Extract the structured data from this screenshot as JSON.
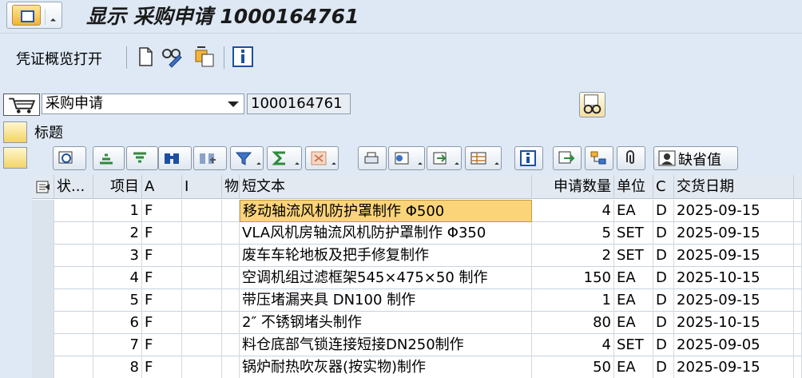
{
  "title": "显示 采购申请 1000164761",
  "toolbar": {
    "doc_overview": "凭证概览打开",
    "icons": [
      "new-document-icon",
      "glasses-pen-icon",
      "copy-icon",
      "info-icon"
    ]
  },
  "header": {
    "doc_type": "采购申请",
    "doc_number": "1000164761"
  },
  "section": {
    "label": "标题"
  },
  "alv_toolbar": {
    "default_label": "缺省值"
  },
  "table": {
    "columns": [
      "状...",
      "项目",
      "A",
      "I",
      "物",
      "短文本",
      "申请数量",
      "单位",
      "C",
      "交货日期"
    ],
    "rows": [
      {
        "item": "1",
        "a": "F",
        "text": "移动轴流风机防护罩制作 Φ500",
        "qty": "4",
        "unit": "EA",
        "c": "D",
        "date": "2025-09-15"
      },
      {
        "item": "2",
        "a": "F",
        "text": "VLA风机房轴流风机防护罩制作 Φ350",
        "qty": "5",
        "unit": "SET",
        "c": "D",
        "date": "2025-09-15"
      },
      {
        "item": "3",
        "a": "F",
        "text": "废车车轮地板及把手修复制作",
        "qty": "2",
        "unit": "SET",
        "c": "D",
        "date": "2025-09-15"
      },
      {
        "item": "4",
        "a": "F",
        "text": "空调机组过滤框架545×475×50 制作",
        "qty": "150",
        "unit": "EA",
        "c": "D",
        "date": "2025-10-15"
      },
      {
        "item": "5",
        "a": "F",
        "text": "带压堵漏夹具 DN100 制作",
        "qty": "1",
        "unit": "EA",
        "c": "D",
        "date": "2025-09-15"
      },
      {
        "item": "6",
        "a": "F",
        "text": "2″ 不锈钢堵头制作",
        "qty": "80",
        "unit": "EA",
        "c": "D",
        "date": "2025-10-15"
      },
      {
        "item": "7",
        "a": "F",
        "text": "料仓底部气锁连接短接DN250制作",
        "qty": "4",
        "unit": "SET",
        "c": "D",
        "date": "2025-09-05"
      },
      {
        "item": "8",
        "a": "F",
        "text": "锅炉耐热吹灰器(按实物)制作",
        "qty": "50",
        "unit": "EA",
        "c": "D",
        "date": "2025-09-15"
      }
    ]
  },
  "colors": {
    "background": "#dfe9f5",
    "highlight": "#fbd47a"
  }
}
